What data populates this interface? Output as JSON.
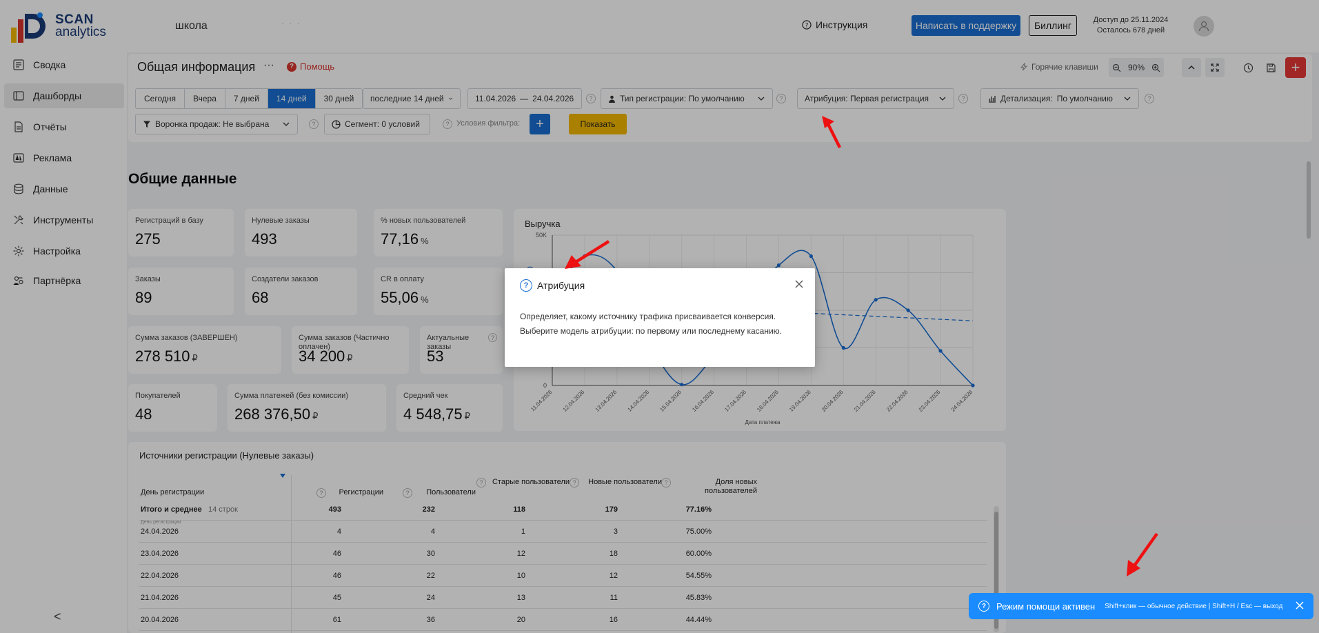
{
  "header": {
    "logo_line1": "SCAN",
    "logo_line2": "analytics",
    "project": "школа",
    "project_extra": "· · ·",
    "instruction": "Инструкция",
    "support_button": "Написать в поддержку",
    "billing_button": "Биллинг",
    "access_until": "Доступ до 25.11.2024",
    "days_left": "Осталось 678 дней"
  },
  "sidebar": {
    "items": [
      {
        "label": "Сводка",
        "icon": "summary-icon"
      },
      {
        "label": "Дашборды",
        "icon": "dashboard-icon",
        "active": true
      },
      {
        "label": "Отчёты",
        "icon": "reports-icon"
      },
      {
        "label": "Реклама",
        "icon": "ads-icon"
      },
      {
        "label": "Данные",
        "icon": "database-icon"
      },
      {
        "label": "Инструменты",
        "icon": "tools-icon"
      },
      {
        "label": "Настройка",
        "icon": "gear-icon"
      },
      {
        "label": "Партнёрка",
        "icon": "partners-icon"
      }
    ],
    "collapse": "<"
  },
  "toolbar": {
    "title": "Общая информация",
    "more": "···",
    "help": "Помощь",
    "hotkeys": "Горячие клавиши",
    "zoom": "90%",
    "periods": [
      "Сегодня",
      "Вчера",
      "7 дней",
      "14 дней",
      "30 дней"
    ],
    "active_period": "14 дней",
    "last_days": "последние 14 дней",
    "date_from": "11.04.2026",
    "date_sep": "—",
    "date_to": "24.04.2026",
    "registration_type": "Тип регистрации: По умолчанию",
    "attribution": "Атрибуция: Первая регистрация",
    "detail": "Детализация:",
    "detail_value": "По умолчанию",
    "funnel": "Воронка продаж: Не выбрана",
    "segment": "Сегмент: 0 условий",
    "filter_conditions": "Условия фильтра:",
    "show_button": "Показать"
  },
  "section": {
    "title": "Общие данные"
  },
  "kpis": {
    "registrations": {
      "label": "Регистраций в базу",
      "value": "275"
    },
    "zero_orders": {
      "label": "Нулевые заказы",
      "value": "493"
    },
    "new_users_pct": {
      "label": "% новых пользователей",
      "value": "77,16",
      "unit": "%"
    },
    "orders": {
      "label": "Заказы",
      "value": "89"
    },
    "order_creators": {
      "label": "Создатели заказов",
      "value": "68"
    },
    "cr_payment": {
      "label": "CR в оплату",
      "value": "55,06",
      "unit": "%"
    },
    "sum_completed": {
      "label": "Сумма заказов (ЗАВЕРШЕН)",
      "value": "278 510",
      "unit": "₽"
    },
    "sum_partial": {
      "label": "Сумма заказов (Частично оплачен)",
      "value": "34 200",
      "unit": "₽"
    },
    "actual_orders": {
      "label": "Актуальные заказы",
      "value": "53"
    },
    "buyers": {
      "label": "Покупателей",
      "value": "48"
    },
    "payments_sum": {
      "label": "Сумма платежей (без комиссии)",
      "value": "268 376,50",
      "unit": "₽"
    },
    "avg_check": {
      "label": "Средний чек",
      "value": "4 548,75",
      "unit": "₽"
    }
  },
  "chart_data": {
    "type": "line",
    "title": "Выручка",
    "xlabel": "Дата платежа",
    "ylabel": "Сумма платежей (без комиссии)",
    "ylim": [
      0,
      50000
    ],
    "y_ticks": [
      "0",
      "50K"
    ],
    "x": [
      "11.04.2026",
      "12.04.2026",
      "13.04.2026",
      "14.04.2026",
      "15.04.2026",
      "16.04.2026",
      "17.04.2026",
      "18.04.2026",
      "19.04.2026",
      "20.04.2026",
      "21.04.2026",
      "22.04.2026",
      "23.04.2026",
      "24.04.2026"
    ],
    "series": [
      {
        "values": [
          30000,
          43000,
          38000,
          14000,
          300,
          10000,
          26000,
          40000,
          43000,
          12500,
          28500,
          25000,
          11500,
          0
        ]
      },
      {
        "values": [
          28000,
          27500,
          27000,
          26500,
          26000,
          25500,
          25000,
          24500,
          24000,
          23500,
          23000,
          22500,
          22000,
          21500
        ],
        "style": "dashed"
      }
    ],
    "grid": true
  },
  "table": {
    "title": "Источники регистрации (Нулевые заказы)",
    "columns": [
      "День регистрации",
      "Регистрации",
      "Пользователи",
      "Старые пользователи",
      "Новые пользователи",
      "Доля новых пользователей"
    ],
    "total_label": "Итого и среднее",
    "total_rows": "14 строк",
    "total": [
      "493",
      "232",
      "118",
      "179",
      "77.16%"
    ],
    "group_hint": "День регистрации",
    "rows": [
      [
        "24.04.2026",
        "4",
        "4",
        "1",
        "3",
        "75.00%"
      ],
      [
        "23.04.2026",
        "46",
        "30",
        "12",
        "18",
        "60.00%"
      ],
      [
        "22.04.2026",
        "46",
        "22",
        "10",
        "12",
        "54.55%"
      ],
      [
        "21.04.2026",
        "45",
        "24",
        "13",
        "11",
        "45.83%"
      ],
      [
        "20.04.2026",
        "61",
        "36",
        "20",
        "16",
        "44.44%"
      ]
    ]
  },
  "tooltip": {
    "title": "Атрибуция",
    "body": "Определяет, какому источнику трафика присваивается конверсия. Выберите модель атрибуции: по первому или последнему касанию."
  },
  "help_mode": {
    "title": "Режим помощи активен",
    "shortcuts": "Shift+клик — обычное действие | Shift+H / Esc — выход"
  },
  "colors": {
    "accent": "#1a6fd3",
    "danger": "#e53935",
    "show": "#f3b800",
    "help_bar": "#1a8cff",
    "arrow": "#ee1111"
  }
}
